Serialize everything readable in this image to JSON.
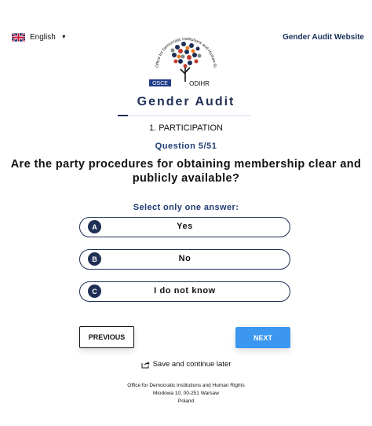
{
  "header": {
    "language": "English",
    "language_icon": "uk-flag-icon",
    "website_link": "Gender Audit Website"
  },
  "logo": {
    "arc_text": "Office for Democratic Institutions and Human Rights",
    "osce": "OSCE",
    "odihr": "ODIHR"
  },
  "page": {
    "title": "Gender Audit",
    "section": "1. PARTICIPATION",
    "question_number": "Question 5/51",
    "question": "Are the party procedures for obtaining membership clear and publicly available?",
    "instruction": "Select only one answer:"
  },
  "answers": [
    {
      "letter": "A",
      "text": "Yes"
    },
    {
      "letter": "B",
      "text": "No"
    },
    {
      "letter": "C",
      "text": "I do not know"
    }
  ],
  "nav": {
    "previous": "PREVIOUS",
    "next": "NEXT",
    "save": "Save and continue later"
  },
  "footer": {
    "line1": "Office for Democratic Institutions and Human Rights",
    "line2": "Miodowa 10, 00-251 Warsaw",
    "line3": "Poland"
  },
  "colors": {
    "navy": "#1f2f55",
    "accent_blue": "#3c97f0",
    "heading_blue": "#1f3b73"
  }
}
